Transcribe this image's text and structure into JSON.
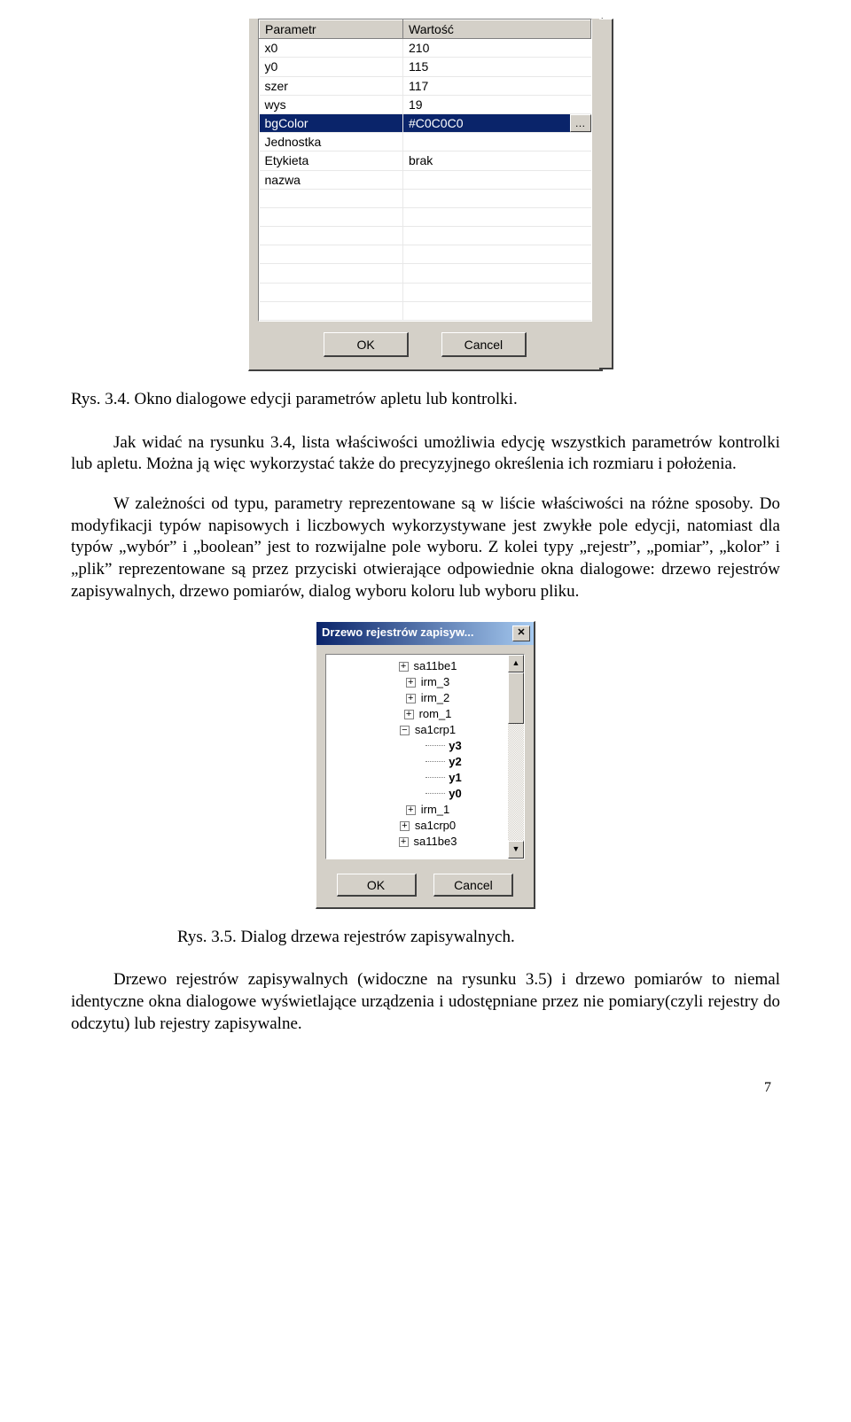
{
  "dialog1": {
    "header_param": "Parametr",
    "header_value": "Wartość",
    "rows": [
      {
        "param": "x0",
        "value": "210",
        "selected": false
      },
      {
        "param": "y0",
        "value": "115",
        "selected": false
      },
      {
        "param": "szer",
        "value": "117",
        "selected": false
      },
      {
        "param": "wys",
        "value": "19",
        "selected": false
      },
      {
        "param": "bgColor",
        "value": "#C0C0C0",
        "selected": true
      },
      {
        "param": "Jednostka",
        "value": "",
        "selected": false
      },
      {
        "param": "Etykieta",
        "value": "brak",
        "selected": false
      },
      {
        "param": "nazwa",
        "value": "",
        "selected": false
      }
    ],
    "ok_label": "OK",
    "cancel_label": "Cancel"
  },
  "caption1": "Rys. 3.4. Okno dialogowe edycji  parametrów apletu lub kontrolki.",
  "para1": "Jak widać na rysunku 3.4, lista właściwości umożliwia edycję wszystkich parametrów kontrolki lub apletu. Można ją więc wykorzystać także do precyzyjnego określenia ich rozmiaru i położenia.",
  "para2": "W zależności od typu, parametry reprezentowane są w liście właściwości na różne sposoby. Do modyfikacji typów napisowych i liczbowych wykorzystywane jest zwykłe pole edycji, natomiast dla typów „wybór” i „boolean” jest to rozwijalne pole wyboru. Z kolei typy „rejestr”, „pomiar”,  „kolor” i „plik” reprezentowane są przez przyciski otwierające odpowiednie okna dialogowe: drzewo rejestrów zapisywalnych, drzewo pomiarów, dialog wyboru koloru lub wyboru pliku.",
  "dialog2": {
    "title": "Drzewo rejestrów zapisyw...",
    "items": [
      {
        "label": "sa11be1",
        "type": "plus"
      },
      {
        "label": "irm_3",
        "type": "plus"
      },
      {
        "label": "irm_2",
        "type": "plus"
      },
      {
        "label": "rom_1",
        "type": "plus"
      },
      {
        "label": "sa1crp1",
        "type": "minus"
      },
      {
        "label": "y3",
        "type": "child"
      },
      {
        "label": "y2",
        "type": "child"
      },
      {
        "label": "y1",
        "type": "child"
      },
      {
        "label": "y0",
        "type": "child"
      },
      {
        "label": "irm_1",
        "type": "plus"
      },
      {
        "label": "sa1crp0",
        "type": "plus"
      },
      {
        "label": "sa11be3",
        "type": "plus"
      }
    ],
    "ok_label": "OK",
    "cancel_label": "Cancel"
  },
  "caption2": "Rys. 3.5. Dialog drzewa rejestrów zapisywalnych.",
  "para3": "Drzewo rejestrów zapisywalnych (widoczne na rysunku 3.5)  i drzewo pomiarów to niemal identyczne okna dialogowe wyświetlające urządzenia i udostępniane przez nie pomiary(czyli rejestry do odczytu) lub rejestry zapisywalne.",
  "page_num": "7"
}
